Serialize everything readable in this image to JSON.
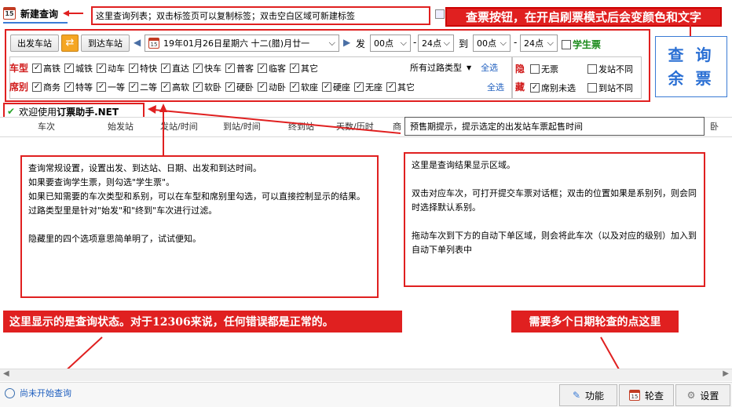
{
  "tabs": {
    "new_query_label": "新建查询",
    "calendar_glyph": "15"
  },
  "hints": {
    "tab_hint": "这里查询列表；双击标签页可以复制标签；双击空白区域可新建标签",
    "query_button_hint": "查票按钮，在开启刷票模式后会变颜色和文字"
  },
  "query": {
    "from_station_label": "出发车站",
    "to_station_label": "到达车站",
    "date_text": "19年01月26日星期六 十二(腊)月廿一",
    "depart_label": "发",
    "depart_from": "00点",
    "depart_to": "24点",
    "arrive_label": "到",
    "arrive_from": "00点",
    "arrive_to": "24点",
    "student_label": "学生票",
    "query_button_line1": "查 询",
    "query_button_line2": "余 票",
    "train_type_label": "车型",
    "train_types": [
      "高铁",
      "城铁",
      "动车",
      "特快",
      "直达",
      "快车",
      "普客",
      "临客",
      "其它"
    ],
    "route_filter": "所有过路类型",
    "select_all": "全选",
    "seat_label": "席别",
    "seat_types": [
      "商务",
      "特等",
      "一等",
      "二等",
      "高软",
      "软卧",
      "硬卧",
      "动卧",
      "软座",
      "硬座",
      "无座",
      "其它"
    ],
    "hidden_label_top": "隐",
    "hidden_label_bottom": "藏",
    "hidden_options": [
      "无票",
      "发站不同",
      "席别未选",
      "到站不同"
    ]
  },
  "welcome": {
    "prefix": "欢迎使用",
    "app_name": "订票助手.NET"
  },
  "table": {
    "columns": [
      "车次",
      "始发站",
      "发站/时间",
      "到站/时间",
      "终到站",
      "天数/历时",
      "商"
    ],
    "tail_column": "卧",
    "tooltip": "预售期提示，提示选定的出发站车票起售时间"
  },
  "notes": {
    "left": [
      "查询常规设置，设置出发、到达站、日期、出发和到达时间。",
      "如果要查询学生票，则勾选\"学生票\"。",
      "如果已知需要的车次类型和系别，可以在车型和席别里勾选，可以直接控制显示的结果。",
      "过路类型里是针对\"始发\"和\"终到\"车次进行过滤。",
      "",
      "隐藏里的四个选项意思简单明了，试试便知。"
    ],
    "right": [
      "这里是查询结果显示区域。",
      "",
      "双击对应车次，可打开提交车票对话框；双击的位置如果是系别列，则会同时选择默认系别。",
      "",
      "拖动车次到下方的自动下单区域，则会将此车次（以及对应的级别）加入到自动下单列表中"
    ],
    "status_hint": "这里显示的是查询状态。对于12306来说，任何错误都是正常的。",
    "multi_date_hint": "需要多个日期轮查的点这里"
  },
  "status": {
    "text": "尚未开始查询"
  },
  "bottom_buttons": {
    "features": "功能",
    "round_query": "轮查",
    "settings": "设置"
  },
  "colors": {
    "accent_red": "#e02020",
    "link_blue": "#1f5fbf",
    "query_blue": "#2a6fd4"
  }
}
